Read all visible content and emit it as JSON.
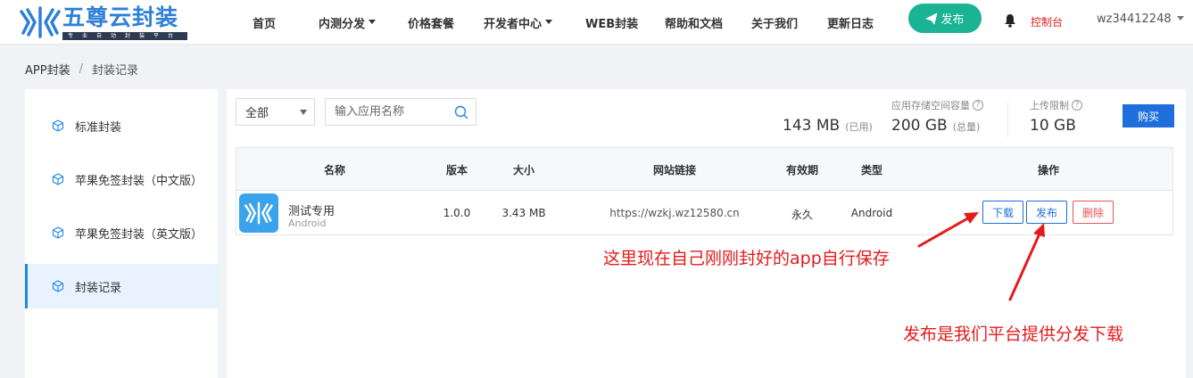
{
  "header": {
    "logo_title": "五尊云封装",
    "logo_sub": "专业自动封装平台",
    "nav": [
      {
        "label": "首页",
        "has_caret": false
      },
      {
        "label": "内测分发",
        "has_caret": true
      },
      {
        "label": "价格套餐",
        "has_caret": false
      },
      {
        "label": "开发者中心",
        "has_caret": true
      },
      {
        "label": "WEB封装",
        "has_caret": false
      },
      {
        "label": "帮助和文档",
        "has_caret": false
      },
      {
        "label": "关于我们",
        "has_caret": false
      },
      {
        "label": "更新日志",
        "has_caret": false
      }
    ],
    "publish_label": "发布",
    "console_label": "控制台",
    "username": "wz34412248"
  },
  "breadcrumb": {
    "root": "APP封装",
    "separator": "/",
    "current": "封装记录"
  },
  "sidebar": {
    "items": [
      {
        "label": "标准封装",
        "active": false
      },
      {
        "label": "苹果免签封装（中文版）",
        "active": false
      },
      {
        "label": "苹果免签封装（英文版）",
        "active": false
      },
      {
        "label": "封装记录",
        "active": true
      }
    ]
  },
  "toolbar": {
    "filter_value": "全部",
    "search_placeholder": "输入应用名称",
    "storage_label": "应用存储空间容量",
    "used_value": "143 MB",
    "used_suffix": "(已用)",
    "total_value": "200 GB",
    "total_suffix": "(总量)",
    "upload_label": "上传限制",
    "upload_value": "10 GB",
    "buy_label": "购买"
  },
  "table": {
    "columns": [
      "名称",
      "版本",
      "大小",
      "网站链接",
      "有效期",
      "类型",
      "操作"
    ],
    "rows": [
      {
        "name": "测试专用",
        "platform": "Android",
        "version": "1.0.0",
        "size": "3.43 MB",
        "url": "https://wzkj.wz12580.cn",
        "validity": "永久",
        "type": "Android",
        "actions": {
          "download": "下载",
          "publish": "发布",
          "delete": "删除"
        }
      }
    ]
  },
  "annotations": {
    "download_note": "这里现在自己刚刚封好的app自行保存",
    "publish_note": "发布是我们平台提供分发下载"
  },
  "colors": {
    "brand_blue": "#2d7fd8",
    "publish_green": "#1ab394",
    "primary_blue": "#1e6fdc",
    "danger_red": "#e85555",
    "annotation_red": "#e41b1b"
  }
}
